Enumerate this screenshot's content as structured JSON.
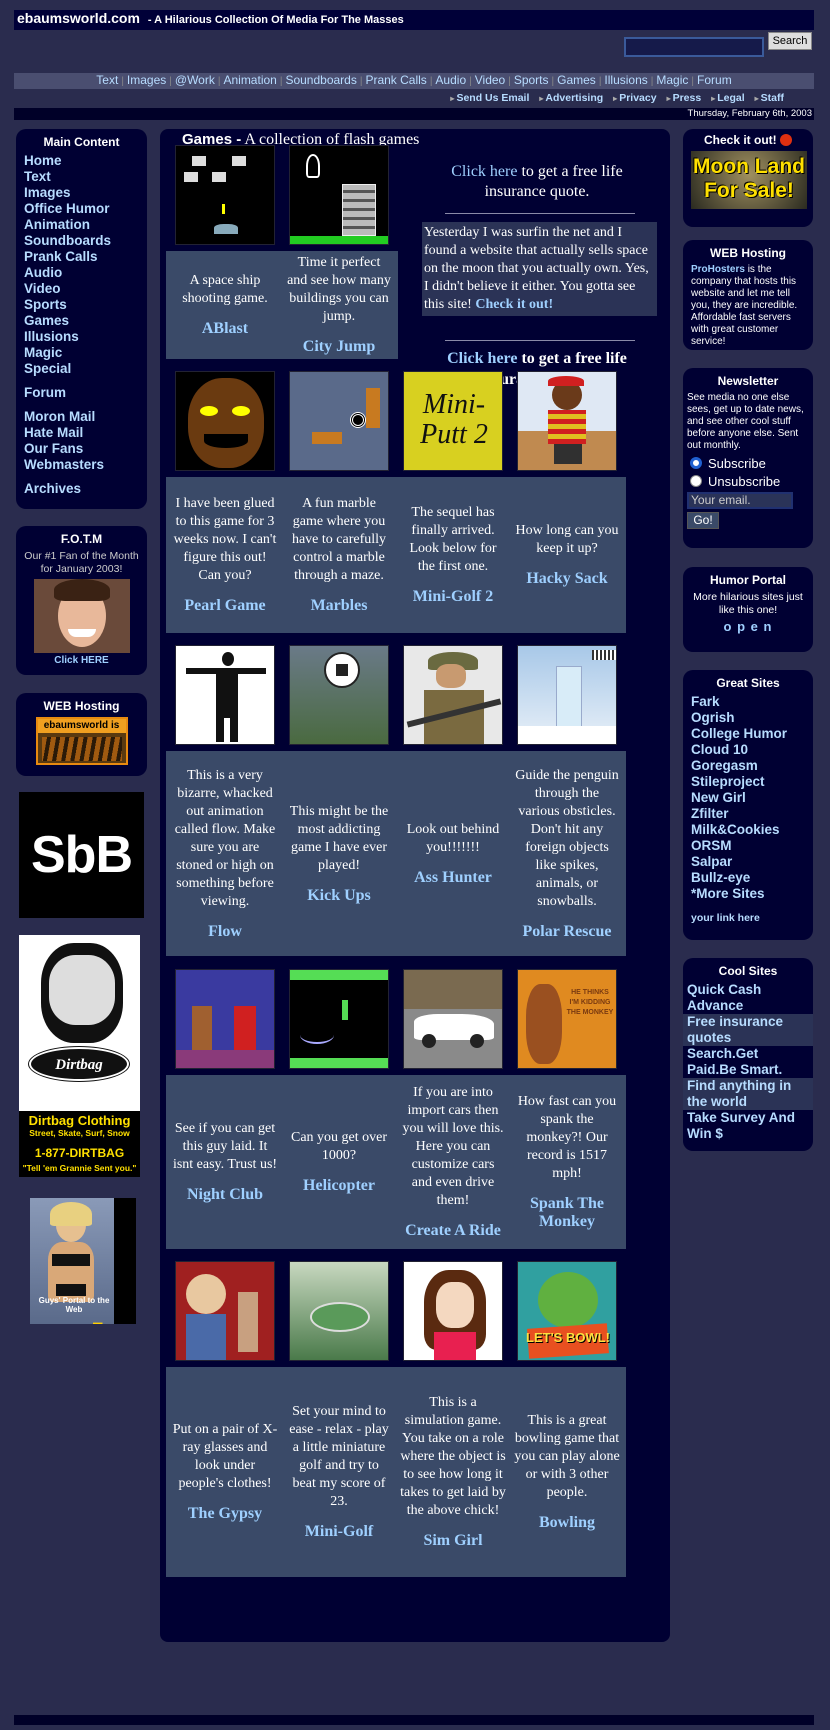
{
  "header": {
    "site": "ebaumsworld.com",
    "tagline": "- A Hilarious Collection Of Media For The Masses",
    "search_button": "Search",
    "date": "Thursday, February 6th, 2003"
  },
  "nav": [
    "Text",
    "Images",
    "@Work",
    "Animation",
    "Soundboards",
    "Prank Calls",
    "Audio",
    "Video",
    "Sports",
    "Games",
    "Illusions",
    "Magic",
    "Forum"
  ],
  "nav2": [
    "Send Us Email",
    "Advertising",
    "Privacy",
    "Press",
    "Legal",
    "Staff"
  ],
  "left": {
    "main_title": "Main Content",
    "items": [
      "Home",
      "Text",
      "Images",
      "Office Humor",
      "Animation",
      "Soundboards",
      "Prank Calls",
      "Audio",
      "Video",
      "Sports",
      "Games",
      "Illusions",
      "Magic",
      "Special"
    ],
    "items2": [
      "Forum"
    ],
    "items3": [
      "Moron Mail",
      "Hate Mail",
      "Our Fans",
      "Webmasters"
    ],
    "items4": [
      "Archives"
    ],
    "fotm_title": "F.O.T.M",
    "fotm_text": "Our #1 Fan of the Month for January 2003!",
    "fotm_link": "Click HERE",
    "hosting_title": "WEB Hosting",
    "hosting_badge": "ebaumsworld is",
    "sbb": "SbB",
    "dirtbag_logo": "Dirtbag",
    "dirtbag_line1": "Dirtbag Clothing",
    "dirtbag_line2": "Street, Skate, Surf, Snow",
    "dirtbag_phone": "1-877-DIRTBAG",
    "dirtbag_quote": "\"Tell 'em Grannie Sent you.\"",
    "bullz_side": "Bullz-EYE.COM",
    "bullz_caption": "Guys' Portal to the Web"
  },
  "main": {
    "title_bold": "Games -",
    "title_rest": "A collection of flash games",
    "promo_link1": "Click here",
    "promo_text1": "to get a free life insurance quote.",
    "promo_story": "Yesterday I was surfin the net and I found a website that actually sells space on the moon that you actually own. Yes, I didn't believe it either. You gotta see this site!",
    "promo_story_link": "Check it out!",
    "promo_link2": "Click here",
    "promo_text2": "to get a free life insurance quote.",
    "games": [
      {
        "name": "ABlast",
        "desc": "A space ship shooting game.",
        "icon": "space-invaders-thumb"
      },
      {
        "name": "City Jump",
        "desc": "Time it perfect and see how many buildings you can jump.",
        "icon": "city-jump-thumb"
      },
      {
        "name": "Pearl Game",
        "desc": "I have been glued to this game for 3 weeks now. I can't figure this out! Can you?",
        "icon": "pearl-thumb"
      },
      {
        "name": "Marbles",
        "desc": "A fun marble game where you have to carefully control a marble through a maze.",
        "icon": "marbles-thumb"
      },
      {
        "name": "Mini-Golf 2",
        "desc": "The sequel has finally arrived. Look below for the first one.",
        "icon": "minigolf2-thumb"
      },
      {
        "name": "Hacky Sack",
        "desc": "How long can you keep it up?",
        "icon": "hacky-thumb"
      },
      {
        "name": "Flow",
        "desc": "This is a very bizarre, whacked out animation called flow. Make sure you are stoned or high on something before viewing.",
        "icon": "flow-thumb"
      },
      {
        "name": "Kick Ups",
        "desc": "This might be the most addicting game I have ever played!",
        "icon": "kickups-thumb"
      },
      {
        "name": "Ass Hunter",
        "desc": "Look out behind you!!!!!!!",
        "icon": "hunter-thumb"
      },
      {
        "name": "Polar Rescue",
        "desc": "Guide the penguin through the various obsticles. Don't hit any foreign objects like spikes, animals, or snowballs.",
        "icon": "polar-thumb"
      },
      {
        "name": "Night Club",
        "desc": "See if you can get this guy laid. It isnt easy. Trust us!",
        "icon": "nightclub-thumb"
      },
      {
        "name": "Helicopter",
        "desc": "Can you get over 1000?",
        "icon": "helicopter-thumb"
      },
      {
        "name": "Create A Ride",
        "desc": "If you are into import cars then you will love this. Here you can customize cars and even drive them!",
        "icon": "car-thumb"
      },
      {
        "name": "Spank The Monkey",
        "desc": "How fast can you spank the monkey?! Our record is 1517 mph!",
        "icon": "monkey-thumb"
      },
      {
        "name": "The Gypsy",
        "desc": "Put on a pair of X-ray glasses and look under people's clothes!",
        "icon": "gypsy-thumb"
      },
      {
        "name": "Mini-Golf",
        "desc": "Set your mind to ease - relax - play a little miniature golf and try to beat my score of 23.",
        "icon": "minigolf-thumb"
      },
      {
        "name": "Sim Girl",
        "desc": "This is a simulation game. You take on a role where the object is to see how long it takes to get laid by the above chick!",
        "icon": "simgirl-thumb"
      },
      {
        "name": "Bowling",
        "desc": "This is a great bowling game that you can play alone or with 3 other people.",
        "icon": "bowling-thumb"
      }
    ],
    "thumb_labels": {
      "minigolf2": "Mini-Putt 2",
      "monkey": "HE THINKS I'M KIDDING THE MONKEY",
      "bowling": "LET'S BOWL!"
    }
  },
  "right": {
    "checkit_title": "Check it out!",
    "moon_ad": "Moon Land For Sale!",
    "hosting_title": "WEB Hosting",
    "hosting_link": "ProHosters",
    "hosting_text": "is the company that hosts this website and let me tell you, they are incredible. Affordable fast servers with great customer service!",
    "newsletter_title": "Newsletter",
    "newsletter_text": "See media no one else sees, get up to date news, and see other cool stuff before anyone else. Sent out monthly.",
    "subscribe": "Subscribe",
    "unsubscribe": "Unsubscribe",
    "email_placeholder": "Your email.",
    "go": "Go!",
    "humor_title": "Humor Portal",
    "humor_text": "More hilarious sites just like this one!",
    "humor_link": "o p e n",
    "great_title": "Great Sites",
    "great_sites": [
      "Fark",
      "Ogrish",
      "College Humor",
      "Cloud 10",
      "Goregasm",
      "Stileproject",
      "New Girl",
      "Zfilter",
      "Milk&Cookies",
      "ORSM",
      "Salpar",
      "Bullz-eye",
      "*More Sites"
    ],
    "your_link": "your link here",
    "cool_title": "Cool Sites",
    "cool_sites": [
      "Quick Cash Advance",
      "Free insurance quotes",
      "Search.Get Paid.Be Smart.",
      "Find anything in the world",
      "Take Survey And Win $"
    ]
  }
}
